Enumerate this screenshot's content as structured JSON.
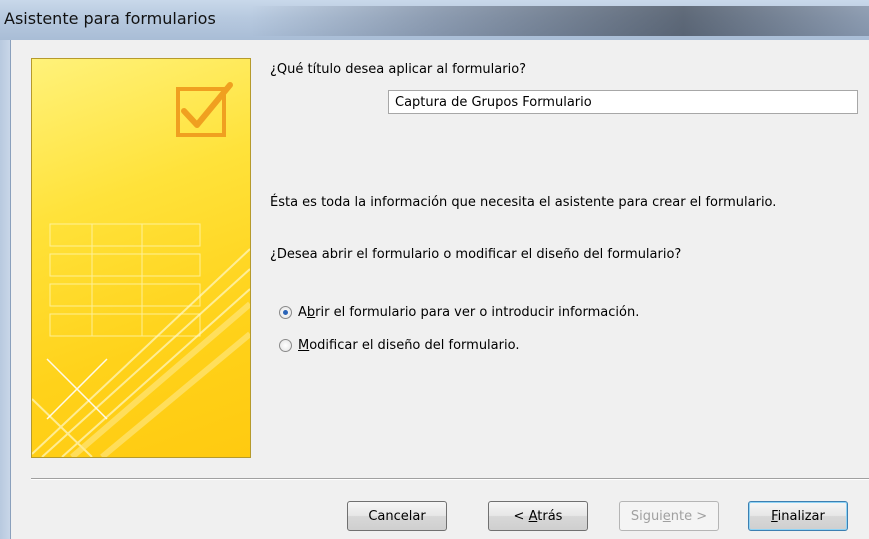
{
  "window": {
    "title": "Asistente para formularios"
  },
  "form": {
    "title_question": "¿Qué título desea aplicar al formulario?",
    "title_value": "Captura de Grupos Formulario",
    "info_text": "Ésta es toda la información que necesita el asistente para crear el formulario.",
    "open_question": "¿Desea abrir el formulario o modificar el diseño del formulario?"
  },
  "options": [
    {
      "prefix": "A",
      "mnemonic": "b",
      "rest": "rir el formulario para ver o introducir información.",
      "selected": true
    },
    {
      "prefix": "",
      "mnemonic": "M",
      "rest": "odificar el diseño del formulario.",
      "selected": false
    }
  ],
  "buttons": {
    "cancel": {
      "label": "Cancelar"
    },
    "back": {
      "prefix": "< ",
      "mnemonic": "A",
      "rest": "trás"
    },
    "next": {
      "prefix": "Sigui",
      "mnemonic": "e",
      "rest": "nte >",
      "enabled": false
    },
    "finish": {
      "prefix": "",
      "mnemonic": "F",
      "rest": "inalizar"
    }
  },
  "colors": {
    "accent_yellow": "#ffd21a",
    "radio_dot": "#2a64b8"
  },
  "icons": {
    "wizard_graphic": "checkbox-form-illustration"
  }
}
